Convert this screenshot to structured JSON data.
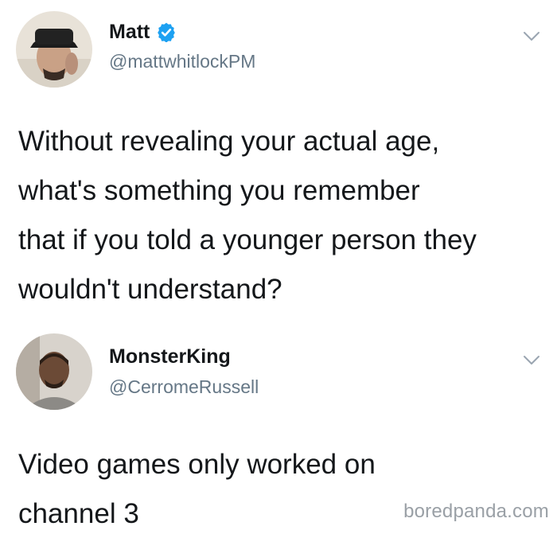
{
  "tweets": [
    {
      "display_name": "Matt",
      "handle": "@mattwhitlockPM",
      "verified": true,
      "text": "Without revealing your actual age,\nwhat's something you remember\nthat if you told a younger person they\nwouldn't understand?"
    },
    {
      "display_name": "MonsterKing",
      "handle": "@CerromeRussell",
      "verified": false,
      "text": "Video games only worked on\nchannel 3"
    }
  ],
  "watermark": "boredpanda.com",
  "colors": {
    "verified": "#1da1f2",
    "handle": "#657786",
    "text": "#14171a"
  }
}
